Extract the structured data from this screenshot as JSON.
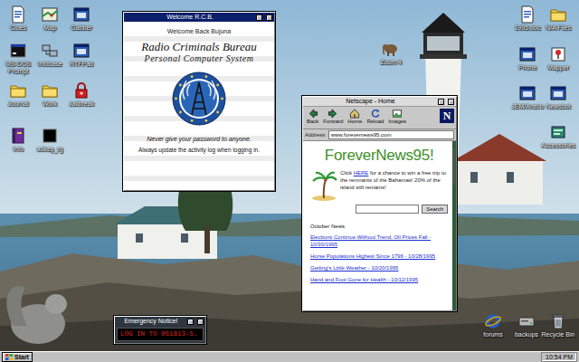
{
  "desktop": {
    "icons": [
      {
        "label": "Clues",
        "kind": "doc"
      },
      {
        "label": "Map",
        "kind": "map"
      },
      {
        "label": "Gabber",
        "kind": "app"
      },
      {
        "label": "MS-DOS Prompt",
        "kind": "dos"
      },
      {
        "label": "Infobase",
        "kind": "network"
      },
      {
        "label": "RTFPad",
        "kind": "app"
      },
      {
        "label": "Journal",
        "kind": "folder"
      },
      {
        "label": "Work",
        "kind": "folder"
      },
      {
        "label": "Jailbreak",
        "kind": "lock"
      },
      {
        "label": "Info",
        "kind": "book"
      },
      {
        "label": "adkey_rg",
        "kind": "blank"
      },
      {
        "label": "Zoom 4",
        "kind": "elephant"
      },
      {
        "label": "1995.doc",
        "kind": "doc"
      },
      {
        "label": "N/A Files",
        "kind": "folder"
      },
      {
        "label": "Phone",
        "kind": "app"
      },
      {
        "label": "Mapper",
        "kind": "pin"
      },
      {
        "label": "JEM/Ansi.b",
        "kind": "app"
      },
      {
        "label": "Newsbot",
        "kind": "app"
      },
      {
        "label": "Accessories",
        "kind": "tools"
      },
      {
        "label": "forums",
        "kind": "ie"
      },
      {
        "label": "backups",
        "kind": "drive"
      },
      {
        "label": "Recycle Bin",
        "kind": "recycle"
      }
    ]
  },
  "welcome_window": {
    "title": "Welcome R.C.B.",
    "greeting": "Welcome Back Bujuna",
    "heading": "Radio Criminals Bureau",
    "subheading": "Personal Computer System",
    "warning": "Never give your password to anyone.",
    "note": "Always update the activity log when logging in."
  },
  "browser_window": {
    "title": "Netscape - Home",
    "toolbar": [
      {
        "label": "Back",
        "kind": "back"
      },
      {
        "label": "Forward",
        "kind": "forward"
      },
      {
        "label": "Home",
        "kind": "home"
      },
      {
        "label": "Reload",
        "kind": "reload"
      },
      {
        "label": "Images",
        "kind": "images"
      }
    ],
    "logo_letter": "N",
    "address_label": "Address:",
    "address": "www.forevernews95.com",
    "page": {
      "logo": "ForeverNews95!",
      "promo_before": "Click ",
      "promo_link": "HERE",
      "promo_after": " for a chance to win a free trip to the remnants of the Bahamas! 20% of the island still remains!",
      "search_button": "Search",
      "section": "October News",
      "news": [
        "Elections Continue Without Trend, Oil Prices Fall - 10/30/1995",
        "Horse Populations Highest Since 1796 - 10/28/1995",
        "Getting's Little Weather - 10/20/1995",
        "Hand and Foot Gone for Health - 10/12/1995"
      ]
    }
  },
  "emergency_window": {
    "title": "Emergency Notice!",
    "message": "LOG IN TO 051813-5."
  },
  "taskbar": {
    "start": "Start",
    "clock": "10:54 PM"
  }
}
